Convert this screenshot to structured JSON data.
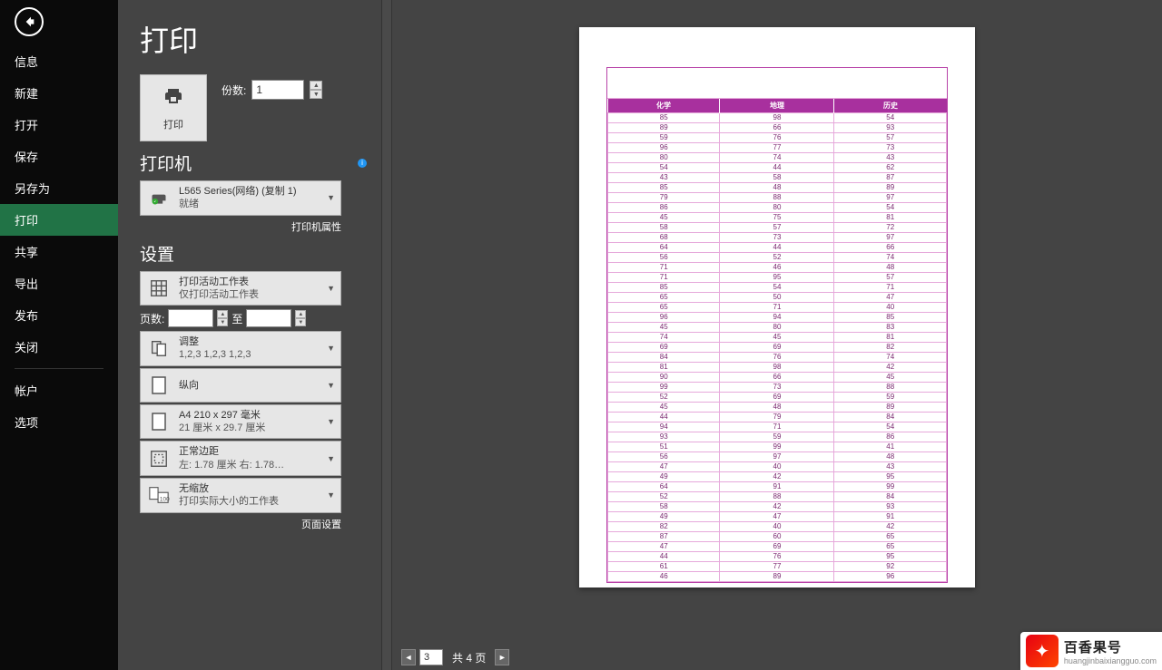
{
  "sidebar": {
    "items": [
      {
        "label": "信息"
      },
      {
        "label": "新建"
      },
      {
        "label": "打开"
      },
      {
        "label": "保存"
      },
      {
        "label": "另存为"
      },
      {
        "label": "打印",
        "active": true
      },
      {
        "label": "共享"
      },
      {
        "label": "导出"
      },
      {
        "label": "发布"
      },
      {
        "label": "关闭"
      }
    ],
    "lower": [
      {
        "label": "帐户"
      },
      {
        "label": "选项"
      }
    ]
  },
  "page_title": "打印",
  "print_button_label": "打印",
  "copies": {
    "label": "份数:",
    "value": "1"
  },
  "printer": {
    "section_title": "打印机",
    "name": "L565 Series(网络) (复制 1)",
    "status": "就绪",
    "properties_link": "打印机属性"
  },
  "settings": {
    "section_title": "设置",
    "active_sheets": {
      "line1": "打印活动工作表",
      "line2": "仅打印活动工作表"
    },
    "page_range": {
      "label": "页数:",
      "to_label": "至"
    },
    "collate": {
      "line1": "调整",
      "line2": "1,2,3    1,2,3    1,2,3"
    },
    "orientation": {
      "line1": "纵向"
    },
    "paper": {
      "line1": "A4 210 x 297 毫米",
      "line2": "21 厘米 x 29.7 厘米"
    },
    "margins": {
      "line1": "正常边距",
      "line2": "左:  1.78 厘米    右:  1.78…"
    },
    "scaling": {
      "line1": "无缩放",
      "line2": "打印实际大小的工作表"
    },
    "page_setup_link": "页面设置"
  },
  "preview_nav": {
    "current": "3",
    "total_label": "共 4 页"
  },
  "chart_data": {
    "type": "table",
    "headers": [
      "化学",
      "地理",
      "历史"
    ],
    "rows": [
      [
        85,
        98,
        54
      ],
      [
        89,
        66,
        93
      ],
      [
        59,
        76,
        57
      ],
      [
        96,
        77,
        73
      ],
      [
        80,
        74,
        43
      ],
      [
        54,
        44,
        62
      ],
      [
        43,
        58,
        87
      ],
      [
        85,
        48,
        89
      ],
      [
        79,
        88,
        97
      ],
      [
        86,
        80,
        54
      ],
      [
        45,
        75,
        81
      ],
      [
        58,
        57,
        72
      ],
      [
        68,
        73,
        97
      ],
      [
        64,
        44,
        66
      ],
      [
        56,
        52,
        74
      ],
      [
        71,
        46,
        48
      ],
      [
        71,
        95,
        57
      ],
      [
        85,
        54,
        71
      ],
      [
        65,
        50,
        47
      ],
      [
        65,
        71,
        40
      ],
      [
        96,
        94,
        85
      ],
      [
        45,
        80,
        83
      ],
      [
        74,
        45,
        81
      ],
      [
        69,
        69,
        82
      ],
      [
        84,
        76,
        74
      ],
      [
        81,
        98,
        42
      ],
      [
        90,
        66,
        45
      ],
      [
        99,
        73,
        88
      ],
      [
        52,
        69,
        59
      ],
      [
        45,
        48,
        89
      ],
      [
        44,
        79,
        84
      ],
      [
        94,
        71,
        54
      ],
      [
        93,
        59,
        86
      ],
      [
        51,
        99,
        41
      ],
      [
        56,
        97,
        48
      ],
      [
        47,
        40,
        43
      ],
      [
        49,
        42,
        95
      ],
      [
        64,
        91,
        99
      ],
      [
        52,
        88,
        84
      ],
      [
        58,
        42,
        93
      ],
      [
        49,
        47,
        91
      ],
      [
        82,
        40,
        42
      ],
      [
        87,
        60,
        65
      ],
      [
        47,
        69,
        65
      ],
      [
        44,
        76,
        95
      ],
      [
        61,
        77,
        92
      ],
      [
        46,
        89,
        96
      ]
    ]
  },
  "watermark": {
    "cn": "百香果号",
    "en": "huangjinbaixiangguo.com"
  }
}
